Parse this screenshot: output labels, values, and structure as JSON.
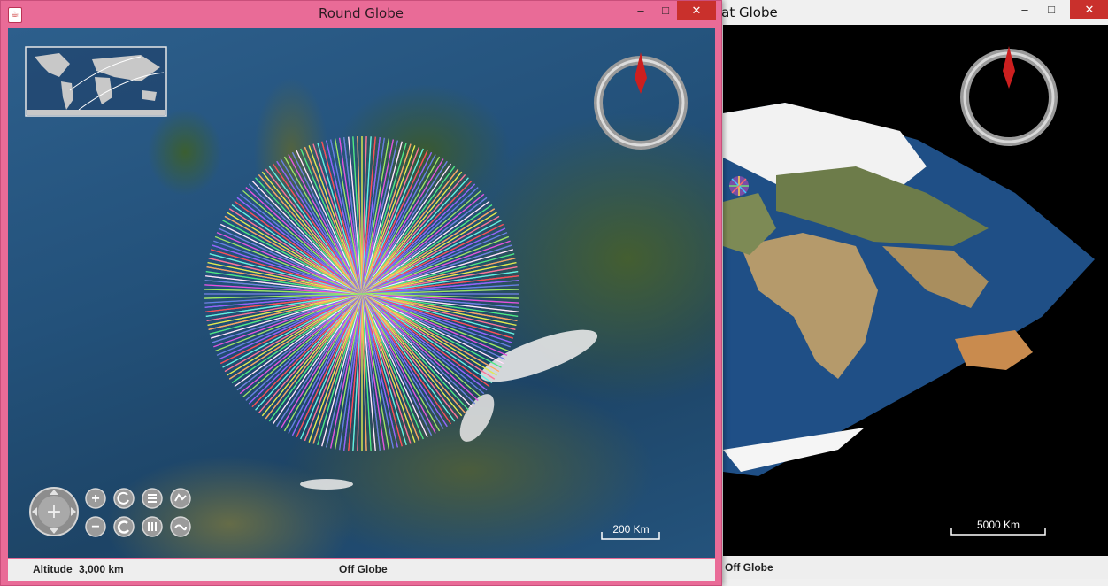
{
  "round_window": {
    "title": "Round Globe",
    "status": {
      "altitude_label": "Altitude",
      "altitude_value": "3,000 km",
      "cursor_status": "Off Globe"
    },
    "scale_bar": "200 Km",
    "controls": [
      "pan-control",
      "zoom-in",
      "zoom-out",
      "heading-left",
      "heading-right",
      "pitch-up",
      "pitch-down",
      "exaggeration-up",
      "exaggeration-down"
    ]
  },
  "flat_window": {
    "title": "Flat Globe",
    "title_visible": "lat Globe",
    "status": {
      "cursor_status": "Off Globe"
    },
    "scale_bar": "5000 Km"
  },
  "window_controls": {
    "minimize": "–",
    "maximize": "□",
    "close": "✕"
  },
  "colors": {
    "title_bar_round": "#e96b97",
    "close_button": "#c9302c",
    "compass_needle": "#cc1f1f"
  }
}
